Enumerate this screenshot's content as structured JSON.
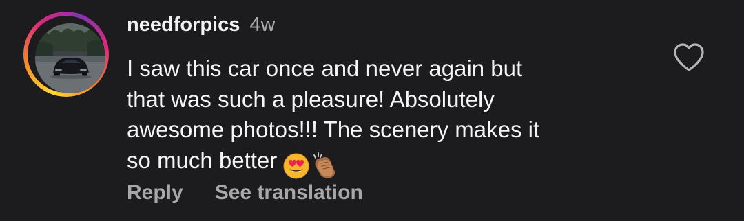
{
  "comment": {
    "username": "needforpics",
    "timestamp": "4w",
    "text_lines": [
      "I saw this car once and never again but",
      "that was such a pleasure! Absolutely",
      "awesome photos!!! The scenery makes it",
      "so much better"
    ],
    "emojis": [
      "heart-eyes-emoji",
      "clapping-hands-emoji"
    ],
    "actions": {
      "reply_label": "Reply",
      "translate_label": "See translation"
    },
    "like_icon": "heart-outline-icon",
    "avatar_icon": "car-profile-photo"
  },
  "colors": {
    "background": "#1c1c1e",
    "text_primary": "#f5f5f5",
    "text_secondary": "#a8a8a8",
    "story_ring": [
      "#fdd835",
      "#f58529",
      "#dd2a7b",
      "#8134af"
    ]
  }
}
